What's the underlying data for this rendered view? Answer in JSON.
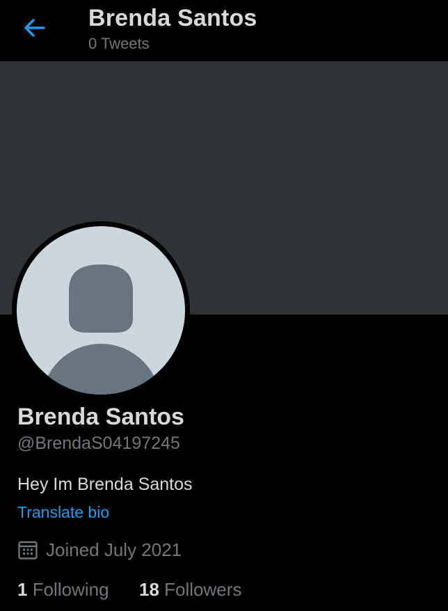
{
  "header": {
    "title": "Brenda Santos",
    "subtitle": "0 Tweets",
    "back_icon": "arrow-left-icon"
  },
  "profile": {
    "display_name": "Brenda Santos",
    "handle": "@BrendaS04197245",
    "bio": "Hey Im Brenda Santos",
    "translate_label": "Translate bio",
    "joined": "Joined July 2021",
    "calendar_icon": "calendar-icon",
    "avatar_icon": "default-avatar-icon"
  },
  "stats": {
    "following_count": "1",
    "following_label": "Following",
    "followers_count": "18",
    "followers_label": "Followers"
  },
  "colors": {
    "background": "#000000",
    "banner": "#2f3336",
    "text_primary": "#d9d9d9",
    "text_secondary": "#71767b",
    "accent": "#1d9bf0",
    "avatar_bg": "#ccd6dd",
    "avatar_fg": "#66757f"
  }
}
